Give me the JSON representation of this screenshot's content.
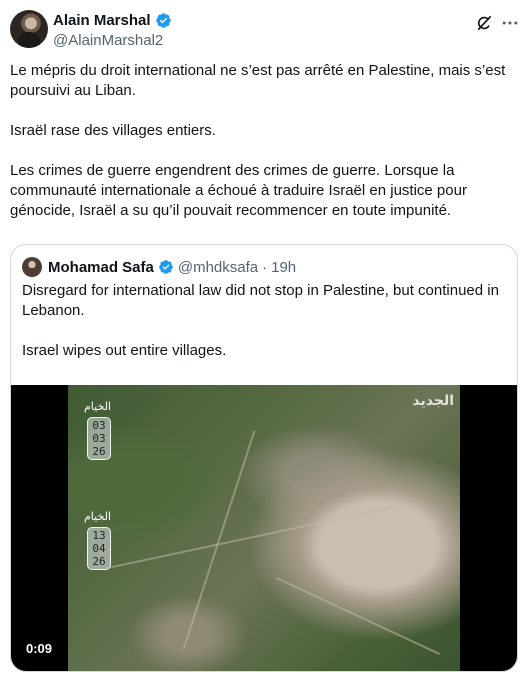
{
  "author": {
    "display_name": "Alain Marshal",
    "handle": "@AlainMarshal2"
  },
  "tweet": {
    "paragraphs": [
      "Le mépris du droit international ne s’est pas arrêté en Palestine, mais s’est poursuivi au Liban.",
      "Israël rase des villages entiers.",
      "Les crimes de guerre engendrent des crimes de guerre. Lorsque la communauté internationale a échoué à traduire Israël en justice pour génocide, Israël a su qu’il pouvait recommencer en toute impunité."
    ]
  },
  "quote": {
    "display_name": "Mohamad Safa",
    "handle": "@mhdksafa",
    "separator": "·",
    "time": "19h",
    "paragraphs": [
      "Disregard for international law did not stop in Palestine, but continued in Lebanon.",
      "Israel wipes out entire villages.",
      "..."
    ],
    "video": {
      "duration": "0:09",
      "channel_logo": "الجديد",
      "frames": [
        {
          "place": "الخيام",
          "date": [
            "03",
            "03",
            "26"
          ]
        },
        {
          "place": "الخيام",
          "date": [
            "13",
            "04",
            "26"
          ]
        }
      ]
    }
  },
  "colors": {
    "verified": "#1d9bf0",
    "text": "#0f1419",
    "muted": "#536471",
    "border": "#cfd9de"
  }
}
